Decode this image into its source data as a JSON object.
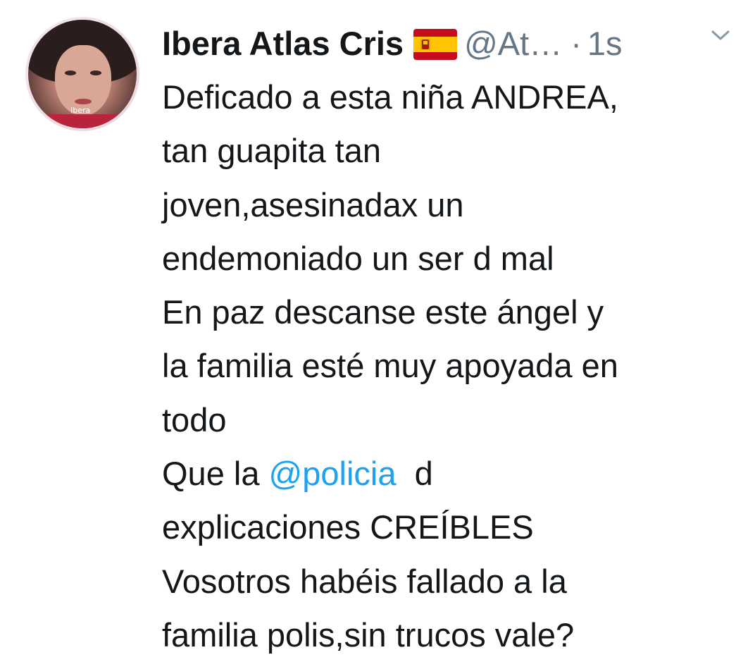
{
  "tweet": {
    "author": {
      "name": "Ibera Atlas Cris",
      "handle": "@At…",
      "avatar_caption": "Ibera",
      "flag_icon": "spain-flag-icon"
    },
    "separator": "·",
    "timestamp": "1s",
    "menu_icon": "chevron-down-icon",
    "body_lines": [
      "Deficado a esta niña ANDREA,",
      "tan guapita tan",
      "joven,asesinadax un",
      "endemoniado un ser d mal",
      "En paz descanse este ángel y",
      "la familia esté muy apoyada en",
      "todo"
    ],
    "police_line": {
      "prefix": "Que la ",
      "mention": "@policia",
      "suffix": "  d"
    },
    "closing_lines": [
      "explicaciones CREÍBLES",
      "Vosotros habéis fallado a la",
      "familia polis,sin trucos vale?"
    ]
  },
  "colors": {
    "text": "#14171a",
    "secondary": "#657786",
    "link": "#1da1f2"
  }
}
